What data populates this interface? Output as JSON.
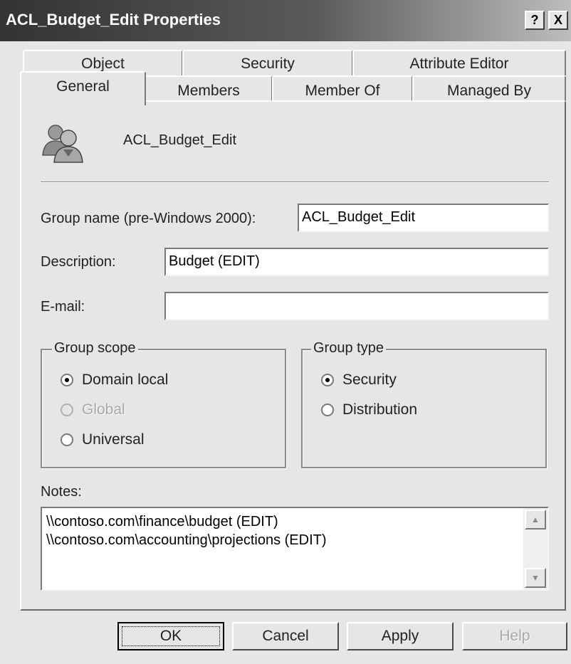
{
  "window": {
    "title": "ACL_Budget_Edit Properties",
    "help_glyph": "?",
    "close_glyph": "X"
  },
  "tabs": {
    "row1": [
      "Object",
      "Security",
      "Attribute Editor"
    ],
    "row2": [
      "General",
      "Members",
      "Member Of",
      "Managed By"
    ],
    "selected": "General"
  },
  "general": {
    "group_display_name": "ACL_Budget_Edit",
    "icon": "group-users-icon",
    "fields": {
      "group_name_label": "Group name (pre-Windows 2000):",
      "group_name_value": "ACL_Budget_Edit",
      "description_label": "Description:",
      "description_value": "Budget (EDIT)",
      "email_label": "E-mail:",
      "email_value": ""
    },
    "group_scope": {
      "legend": "Group scope",
      "options": [
        "Domain local",
        "Global",
        "Universal"
      ],
      "selected": "Domain local",
      "disabled": [
        "Global"
      ]
    },
    "group_type": {
      "legend": "Group type",
      "options": [
        "Security",
        "Distribution"
      ],
      "selected": "Security"
    },
    "notes": {
      "label": "Notes:",
      "lines": [
        "\\\\contoso.com\\finance\\budget (EDIT)",
        "\\\\contoso.com\\accounting\\projections (EDIT)"
      ]
    }
  },
  "buttons": {
    "ok": "OK",
    "cancel": "Cancel",
    "apply": "Apply",
    "help": "Help"
  }
}
